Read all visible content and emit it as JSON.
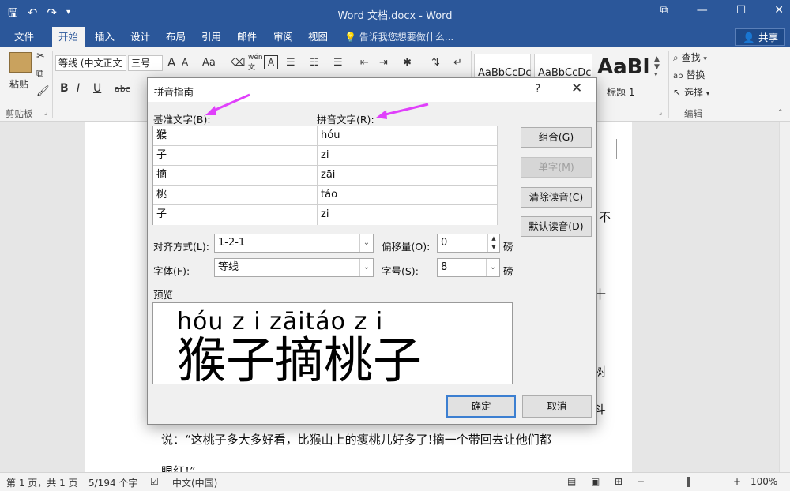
{
  "window": {
    "title": "Word 文档.docx - Word",
    "qat": {
      "save": "🖫",
      "undo": "↶",
      "redo": "↷",
      "more": "▾"
    },
    "controls": {
      "ribbon": "⧉",
      "minimize": "—",
      "maximize": "☐",
      "close": "✕"
    }
  },
  "tabs": [
    {
      "label": "文件"
    },
    {
      "label": "开始"
    },
    {
      "label": "插入"
    },
    {
      "label": "设计"
    },
    {
      "label": "布局"
    },
    {
      "label": "引用"
    },
    {
      "label": "邮件"
    },
    {
      "label": "审阅"
    },
    {
      "label": "视图"
    }
  ],
  "tellme": "告诉我您想要做什么...",
  "share": "共享",
  "ribbon": {
    "paste": "粘贴",
    "clipboard_group": "剪贴板",
    "font_name": "等线 (中文正文",
    "font_size": "三号",
    "bold": "B",
    "italic": "I",
    "underline": "U",
    "strike": "abc",
    "grow": "A",
    "shrink": "A",
    "case": "Aa",
    "style1": "AaBbCcDc",
    "style2": "AaBbCcDc",
    "style3": "AaBl",
    "style3_label": "标题 1",
    "find": "查找",
    "replace": "替换",
    "select": "选择",
    "edit_group": "编辑"
  },
  "document": {
    "line_right1": "不",
    "line_right2": "十",
    "line_right3": "树",
    "line_right4": "斗",
    "main_line": "说：“这桃子多大多好看，比猴山上的瘦桃儿好多了!摘一个带回去让他们都",
    "next_line": "眼红!”"
  },
  "status": {
    "page": "第 1 页，共 1 页",
    "words": "5/194 个字",
    "lang": "中文(中国)",
    "zoom": "100%",
    "zoom_minus": "−",
    "zoom_plus": "+"
  },
  "dialog": {
    "title": "拼音指南",
    "help": "?",
    "close": "✕",
    "base_label": "基准文字(B):",
    "ruby_label": "拼音文字(R):",
    "rows": [
      {
        "base": "猴",
        "ruby": "hóu"
      },
      {
        "base": "子",
        "ruby": "zi"
      },
      {
        "base": "摘",
        "ruby": "zāi"
      },
      {
        "base": "桃",
        "ruby": "táo"
      },
      {
        "base": "子",
        "ruby": "zi"
      }
    ],
    "btn_group": "组合(G)",
    "btn_single": "单字(M)",
    "btn_clear": "清除读音(C)",
    "btn_default": "默认读音(D)",
    "align_label": "对齐方式(L):",
    "align_value": "1-2-1",
    "offset_label": "偏移量(O):",
    "offset_value": "0",
    "font_label": "字体(F):",
    "font_value": "等线",
    "size_label": "字号(S):",
    "size_value": "8",
    "unit": "磅",
    "preview_label": "预览",
    "preview_pinyin": "hóu z i zāitáo z i",
    "preview_hanzi": "猴子摘桃子",
    "ok": "确定",
    "cancel": "取消"
  },
  "colors": {
    "title_bar": "#2b579a",
    "arrow": "#e040fb"
  }
}
